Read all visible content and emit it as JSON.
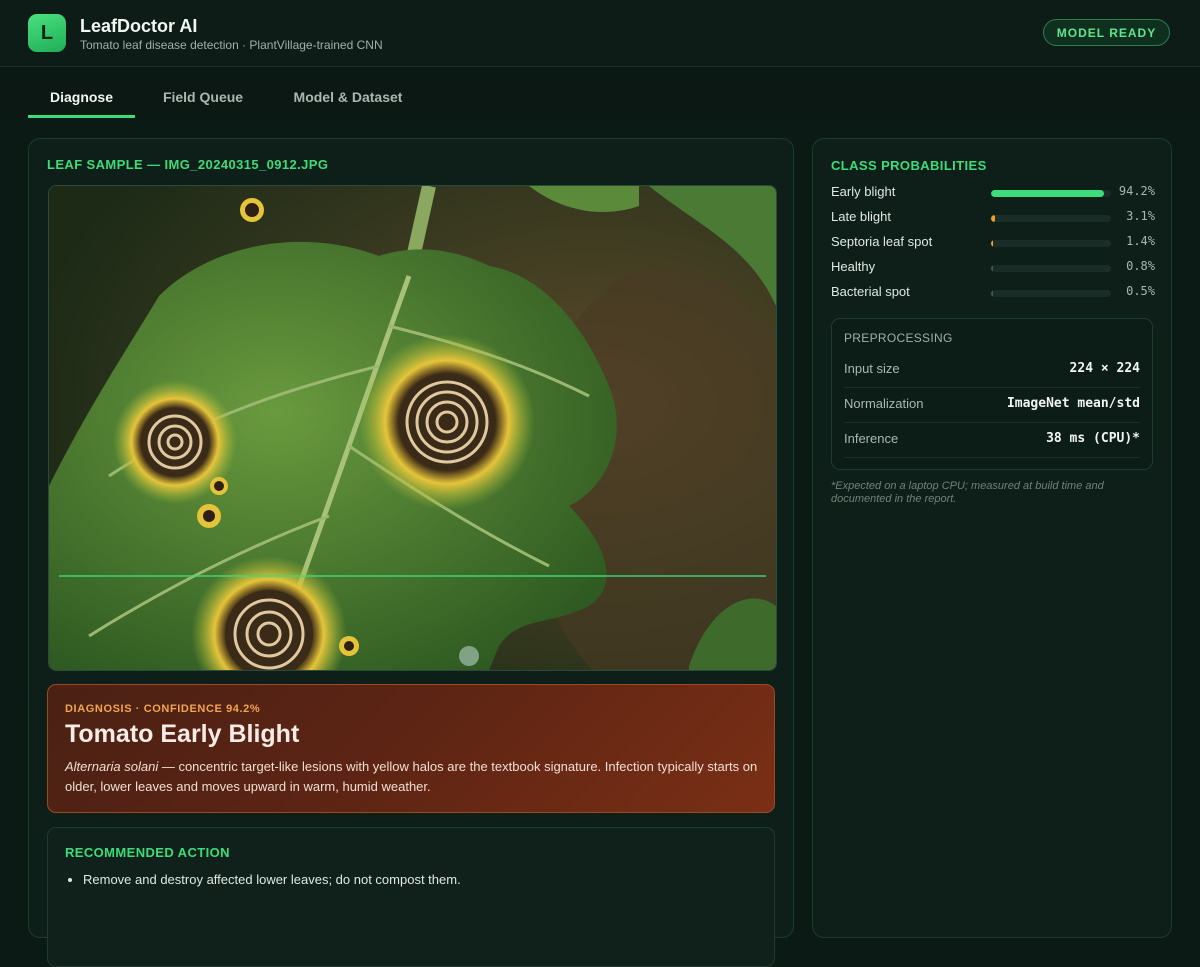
{
  "header": {
    "logo_letter": "L",
    "title": "LeafDoctor AI",
    "subtitle": "Tomato leaf disease detection · PlantVillage-trained CNN",
    "status": "MODEL READY"
  },
  "tabs": [
    {
      "label": "Diagnose",
      "active": true
    },
    {
      "label": "Field Queue",
      "active": false
    },
    {
      "label": "Model & Dataset",
      "active": false
    }
  ],
  "sample": {
    "label": "LEAF SAMPLE — IMG_20240315_0912.JPG"
  },
  "diagnosis": {
    "eyebrow": "DIAGNOSIS · CONFIDENCE 94.2%",
    "title": "Tomato Early Blight",
    "pathogen": "Alternaria solani",
    "description": " — concentric target-like lesions with yellow halos are the textbook signature. Infection typically starts on older, lower leaves and moves upward in warm, humid weather."
  },
  "action": {
    "label": "RECOMMENDED ACTION",
    "items": [
      "Remove and destroy affected lower leaves; do not compost them."
    ]
  },
  "probabilities": {
    "label": "CLASS PROBABILITIES",
    "classes": [
      {
        "name": "Early blight",
        "value": "94.2%",
        "fraction": 0.942,
        "color": "#3ddc7a"
      },
      {
        "name": "Late blight",
        "value": "3.1%",
        "fraction": 0.031,
        "color": "#f0a020"
      },
      {
        "name": "Septoria leaf spot",
        "value": "1.4%",
        "fraction": 0.014,
        "color": "#f0a020"
      },
      {
        "name": "Healthy",
        "value": "0.8%",
        "fraction": 0.008,
        "color": "#3a5a4c"
      },
      {
        "name": "Bacterial spot",
        "value": "0.5%",
        "fraction": 0.005,
        "color": "#3a5a4c"
      }
    ]
  },
  "preprocessing": {
    "title": "PREPROCESSING",
    "rows": [
      {
        "key": "Input size",
        "value": "224 × 224"
      },
      {
        "key": "Normalization",
        "value": "ImageNet mean/std"
      },
      {
        "key": "Inference",
        "value": "38 ms (CPU)*"
      }
    ],
    "footnote": "*Expected on a laptop CPU; measured at build time and documented in the report."
  },
  "colors": {
    "accent": "#3ddc7a",
    "warning": "#f0a020",
    "diagnosis_bg": "#5c2414"
  }
}
